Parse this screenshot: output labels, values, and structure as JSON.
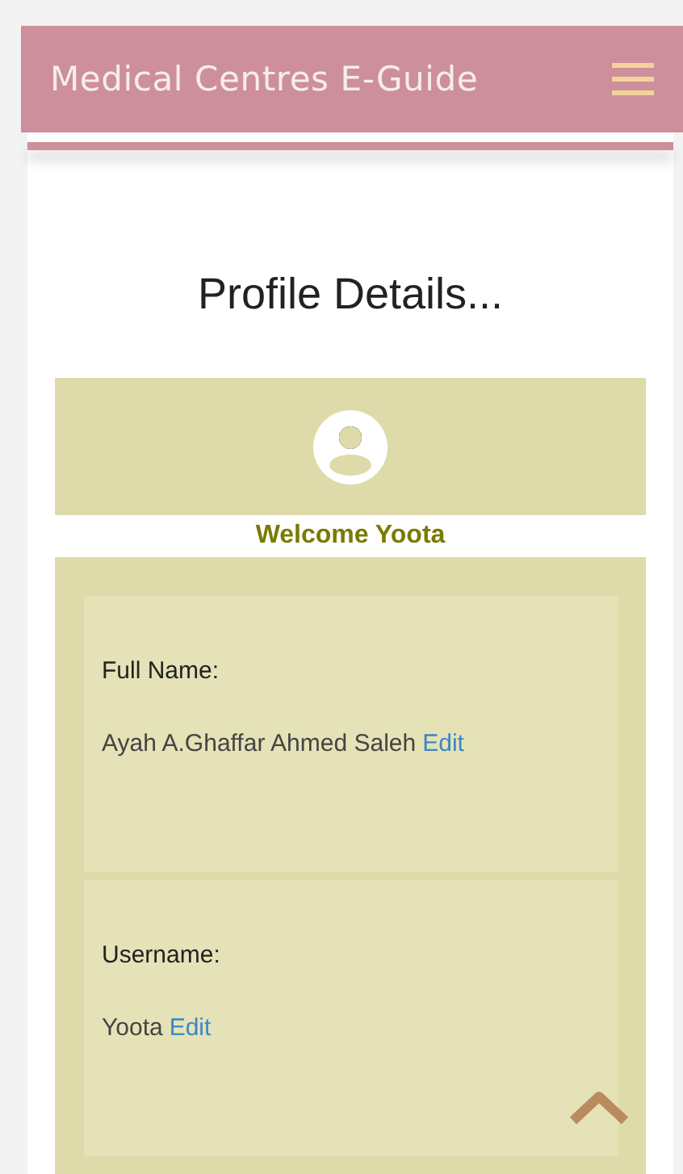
{
  "header": {
    "title": "Medical Centres E-Guide"
  },
  "page_title": "Profile Details...",
  "welcome": "Welcome  Yoota",
  "fields": [
    {
      "label": "Full Name:",
      "value": "Ayah A.Ghaffar Ahmed Saleh",
      "action": "Edit"
    },
    {
      "label": "Username:",
      "value": "Yoota",
      "action": "Edit"
    }
  ]
}
